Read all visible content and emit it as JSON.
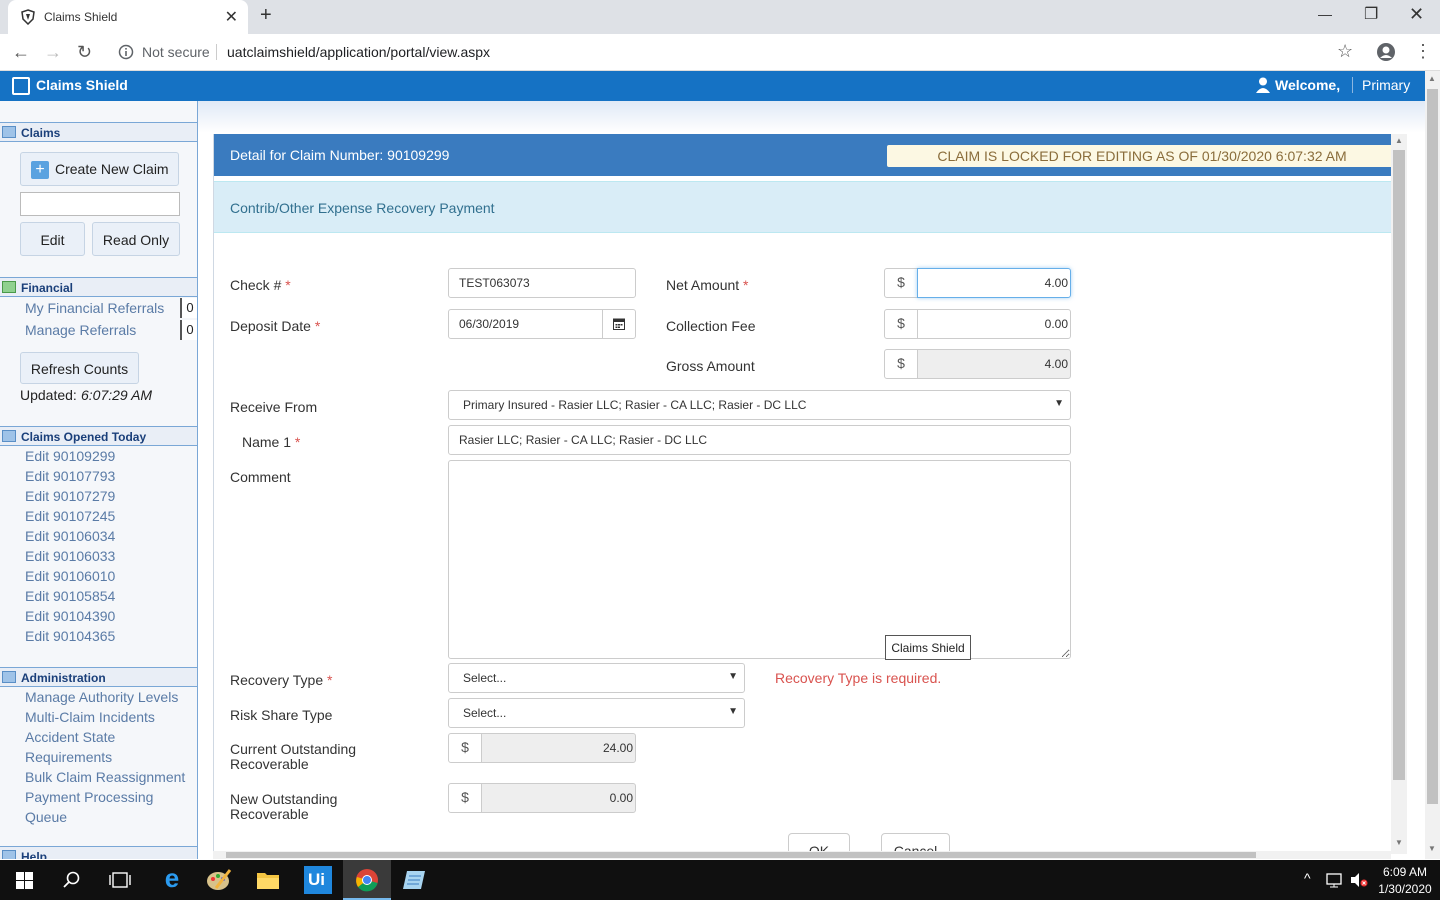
{
  "browser": {
    "tab_title": "Claims Shield",
    "close_glyph": "✕",
    "new_tab_glyph": "+",
    "not_secure": "Not secure",
    "url": "uatclaimshield/application/portal/view.aspx",
    "icons": [
      "back-icon",
      "forward-icon",
      "reload-icon",
      "info-icon",
      "star-icon",
      "profile-icon",
      "menu-icon"
    ]
  },
  "app": {
    "name": "Claims Shield",
    "welcome": "Welcome,",
    "user": "Primary",
    "accent": "#1572c4"
  },
  "sidebar": {
    "claims_header": "Claims",
    "create_new_claim": "Create New Claim",
    "claim_search_value": "",
    "edit_button": "Edit",
    "read_only_button": "Read Only",
    "financial_header": "Financial",
    "my_financial_referrals": "My Financial Referrals",
    "my_financial_referrals_count": "0",
    "manage_referrals": "Manage Referrals",
    "manage_referrals_count": "0",
    "refresh_counts": "Refresh Counts",
    "updated_label": "Updated:",
    "updated_time": "6:07:29 AM",
    "claims_opened_header": "Claims Opened Today",
    "claims_opened": [
      "Edit 90109299",
      "Edit 90107793",
      "Edit 90107279",
      "Edit 90107245",
      "Edit 90106034",
      "Edit 90106033",
      "Edit 90106010",
      "Edit 90105854",
      "Edit 90104390",
      "Edit 90104365"
    ],
    "admin_header": "Administration",
    "admin_links": [
      "Manage Authority Levels",
      "Multi-Claim Incidents",
      "Accident State",
      "Requirements",
      "Bulk Claim Reassignment",
      "Payment Processing",
      "Queue"
    ],
    "help_header": "Help"
  },
  "panel": {
    "title": "Detail for Claim Number: 90109299",
    "locked_notice": "CLAIM IS LOCKED FOR EDITING AS OF 01/30/2020 6:07:32 AM",
    "subtitle": "Contrib/Other Expense Recovery Payment",
    "required_mark": "*",
    "currency": "$",
    "check_label": "Check #",
    "check_value": "TEST063073",
    "deposit_date_label": "Deposit Date",
    "deposit_date_value": "06/30/2019",
    "net_amount_label": "Net Amount",
    "net_amount_value": "4.00",
    "collection_fee_label": "Collection Fee",
    "collection_fee_value": "0.00",
    "gross_amount_label": "Gross Amount",
    "gross_amount_value": "4.00",
    "receive_from_label": "Receive From",
    "receive_from_value": "Primary Insured - Rasier LLC; Rasier - CA LLC; Rasier - DC LLC",
    "name1_label": "Name 1",
    "name1_value": "Rasier LLC; Rasier - CA LLC; Rasier - DC LLC",
    "comment_label": "Comment",
    "comment_value": "",
    "tooltip": "Claims Shield",
    "recovery_type_label": "Recovery Type",
    "recovery_type_value": "Select...",
    "recovery_type_error": "Recovery Type is required.",
    "risk_share_label": "Risk Share Type",
    "risk_share_value": "Select...",
    "current_outstanding_label_1": "Current Outstanding",
    "current_outstanding_label_2": "Recoverable",
    "current_outstanding_value": "24.00",
    "new_outstanding_label_1": "New Outstanding",
    "new_outstanding_label_2": "Recoverable",
    "new_outstanding_value": "0.00",
    "ok_button": "OK",
    "cancel_button": "Cancel"
  },
  "taskbar": {
    "time": "6:09 AM",
    "date": "1/30/2020",
    "apps": [
      "start-icon",
      "search-icon",
      "task-view-icon",
      "ie-icon",
      "paint-icon",
      "file-explorer-icon",
      "uipath-icon",
      "chrome-icon",
      "notepad-icon"
    ]
  }
}
